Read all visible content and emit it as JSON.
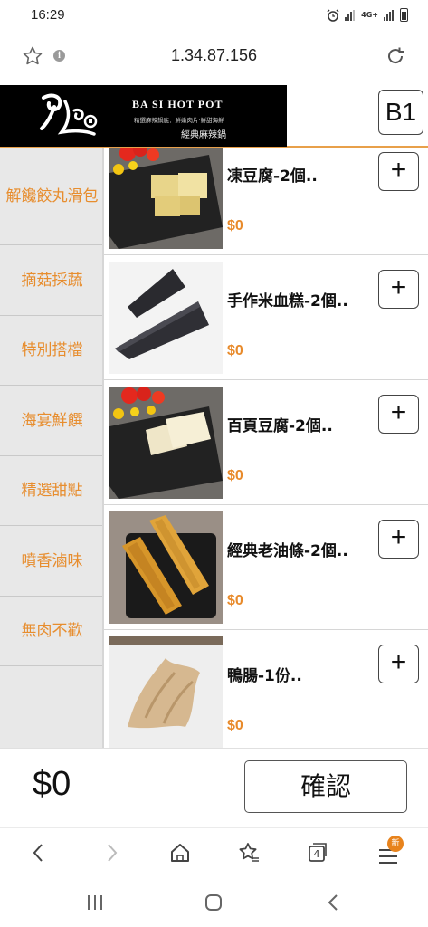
{
  "status_bar": {
    "time": "16:29",
    "network": "4G+"
  },
  "browser": {
    "url": "1.34.87.156"
  },
  "shop": {
    "name": "BA SI HOT POT",
    "slogan": "精選麻辣鍋底．鮮嫩肉片‧鮮甜海鮮",
    "subtitle": "經典麻辣鍋",
    "table": "B1"
  },
  "categories": [
    "解饞餃丸滑包",
    "摘菇採蔬",
    "特別搭檔",
    "海宴鮮饌",
    "精選甜點",
    "噴香滷味",
    "無肉不歡"
  ],
  "items": [
    {
      "name": "凍豆腐-2個..",
      "price": "$0",
      "add": "+"
    },
    {
      "name": "手作米血糕-2個..",
      "price": "$0",
      "add": "+"
    },
    {
      "name": "百頁豆腐-2個..",
      "price": "$0",
      "add": "+"
    },
    {
      "name": "經典老油條-2個..",
      "price": "$0",
      "add": "+"
    },
    {
      "name": "鴨腸-1份..",
      "price": "$0",
      "add": "+"
    }
  ],
  "cart": {
    "total": "$0",
    "confirm_label": "確認"
  },
  "browser_nav": {
    "tabs_count": "4",
    "menu_badge": "新"
  },
  "colors": {
    "accent": "#e8a04a",
    "category_text": "#e78d2e",
    "price": "#e88a2a"
  }
}
